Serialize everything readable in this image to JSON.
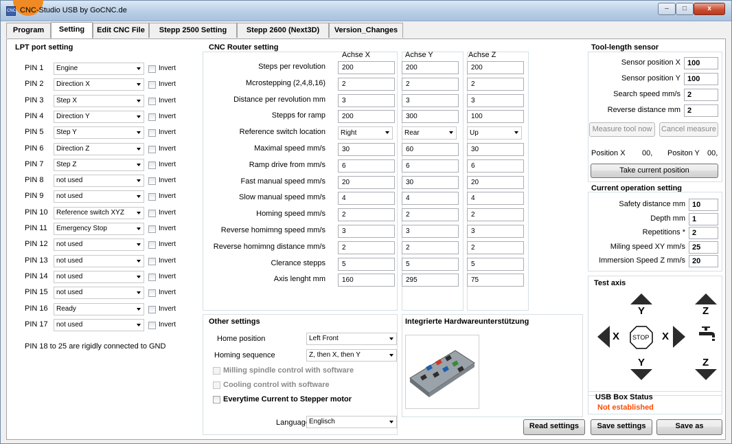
{
  "window": {
    "title": "CNC-Studio USB by GoCNC.de",
    "app_icon_text": "CNC",
    "controls": {
      "minimize": "–",
      "maximize": "□",
      "close": "x"
    }
  },
  "tabs": [
    "Program",
    "Setting",
    "Edit CNC File",
    "Stepp 2500 Setting",
    "Stepp 2600 (Next3D)",
    "Version_Changes"
  ],
  "lpt": {
    "title": "LPT port setting",
    "invert_label": "Invert",
    "pins": [
      {
        "name": "PIN 1",
        "value": "Engine"
      },
      {
        "name": "PIN 2",
        "value": "Direction X"
      },
      {
        "name": "PIN 3",
        "value": "Step X"
      },
      {
        "name": "PIN 4",
        "value": "Direction Y"
      },
      {
        "name": "PIN 5",
        "value": "Step Y"
      },
      {
        "name": "PIN 6",
        "value": "Direction Z"
      },
      {
        "name": "PIN 7",
        "value": "Step Z"
      },
      {
        "name": "PIN 8",
        "value": "not used"
      },
      {
        "name": "PIN 9",
        "value": "not used"
      },
      {
        "name": "PIN 10",
        "value": "Reference switch XYZ"
      },
      {
        "name": "PIN 11",
        "value": "Emergency Stop"
      },
      {
        "name": "PIN 12",
        "value": "not used"
      },
      {
        "name": "PIN 13",
        "value": "not used"
      },
      {
        "name": "PIN 14",
        "value": "not used"
      },
      {
        "name": "PIN 15",
        "value": "not used"
      },
      {
        "name": "PIN 16",
        "value": "Ready"
      },
      {
        "name": "PIN 17",
        "value": "not used"
      }
    ],
    "note": "PIN 18 to 25 are rigidly connected to GND"
  },
  "router": {
    "title": "CNC Router setting",
    "axes": [
      "Achse X",
      "Achse Y",
      "Achse Z"
    ],
    "rows": [
      {
        "label": "Steps per revolution",
        "values": [
          "200",
          "200",
          "200"
        ]
      },
      {
        "label": "Mcrostepping (2,4,8,16)",
        "values": [
          "2",
          "2",
          "2"
        ]
      },
      {
        "label": "Distance per revolution mm",
        "values": [
          "3",
          "3",
          "3"
        ]
      },
      {
        "label": "Stepps for ramp",
        "values": [
          "200",
          "300",
          "100"
        ]
      },
      {
        "label": "Reference switch location",
        "values": [
          "Right",
          "Rear",
          "Up"
        ]
      },
      {
        "label": "Maximal speed mm/s",
        "values": [
          "30",
          "60",
          "30"
        ]
      },
      {
        "label": "Ramp drive from mm/s",
        "values": [
          "6",
          "6",
          "6"
        ]
      },
      {
        "label": "Fast manual speed mm/s",
        "values": [
          "20",
          "30",
          "20"
        ]
      },
      {
        "label": "Slow manual speed mm/s",
        "values": [
          "4",
          "4",
          "4"
        ]
      },
      {
        "label": "Homing speed mm/s",
        "values": [
          "2",
          "2",
          "2"
        ]
      },
      {
        "label": "Reverse homimng speed mm/s",
        "values": [
          "3",
          "3",
          "3"
        ]
      },
      {
        "label": "Reverse homimng distance mm/s",
        "values": [
          "2",
          "2",
          "2"
        ]
      },
      {
        "label": "Clerance stepps",
        "values": [
          "5",
          "5",
          "5"
        ]
      },
      {
        "label": "Axis lenght mm",
        "values": [
          "160",
          "295",
          "75"
        ]
      }
    ]
  },
  "other": {
    "title": "Other settings",
    "home_position_label": "Home position",
    "home_position_value": "Left Front",
    "homing_sequence_label": "Homing sequence",
    "homing_sequence_value": "Z, then X, then Y",
    "milling_spindle": "Milling spindle control with software",
    "cooling": "Cooling control with software",
    "everytime_current": "Everytime Current to Stepper motor",
    "language_label": "Language",
    "language_value": "Englisch"
  },
  "hardware": {
    "title": "Integrierte Hardwareunterstützung"
  },
  "tool_sensor": {
    "title": "Tool-length sensor",
    "rows": [
      {
        "label": "Sensor position X",
        "value": "100"
      },
      {
        "label": "Sensor position Y",
        "value": "100"
      },
      {
        "label": "Search speed mm/s",
        "value": "2"
      },
      {
        "label": "Reverse distance mm",
        "value": "2"
      }
    ],
    "measure_btn": "Measure tool now",
    "cancel_btn": "Cancel measure",
    "position_x_label": "Position X",
    "position_x_value": "00,",
    "position_y_label": "Positon Y",
    "position_y_value": "00,",
    "take_position_btn": "Take current position"
  },
  "operation": {
    "title": "Current operation setting",
    "rows": [
      {
        "label": "Safety distance mm",
        "value": "10"
      },
      {
        "label": "Depth mm",
        "value": "1"
      },
      {
        "label": "Repetitions *",
        "value": "2"
      },
      {
        "label": "Miling speed XY mm/s",
        "value": "25"
      },
      {
        "label": "Immersion Speed Z mm/s",
        "value": "20"
      }
    ]
  },
  "test_axis": {
    "title": "Test axis",
    "y_label": "Y",
    "z_label": "Z",
    "x_label": "X",
    "stop_label": "STOP"
  },
  "usb": {
    "title": "USB Box Status",
    "status": "Not established",
    "status_color": "#ff4b00"
  },
  "buttons": {
    "read": "Read settings",
    "save": "Save settings",
    "save_as": "Save as"
  }
}
